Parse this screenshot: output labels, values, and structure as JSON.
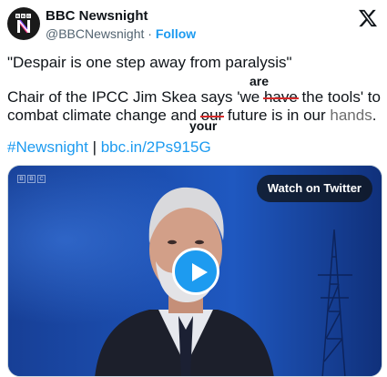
{
  "account": {
    "display_name": "BBC Newsnight",
    "handle": "@BBCNewsnight",
    "separator": "·",
    "follow_label": "Follow",
    "logo_letters": [
      "B",
      "B",
      "C"
    ]
  },
  "tweet": {
    "quote": "\"Despair is one step away from paralysis\"",
    "line2_before": "Chair of the IPCC Jim Skea says 'we ",
    "line2_struck": "have",
    "line2_after": " the tools' to",
    "line2_insert": "are",
    "line3_before": "combat climate change and ",
    "line3_struck": "our",
    "line3_after": " future is in our ",
    "line3_hands": "hands",
    "line3_end": ".",
    "line3_insert": "your",
    "hashtag": "#Newsnight",
    "divider": "|",
    "link": "bbc.in/2Ps915G"
  },
  "media": {
    "watch_label": "Watch on Twitter",
    "watermark_letters": [
      "B",
      "B",
      "C"
    ]
  },
  "colors": {
    "accent": "#1d9bf0",
    "strike": "#d52a2a",
    "studio_blue": "#1d4ca6"
  },
  "icons": {
    "x_logo": "x-logo-icon",
    "play": "play-icon"
  }
}
